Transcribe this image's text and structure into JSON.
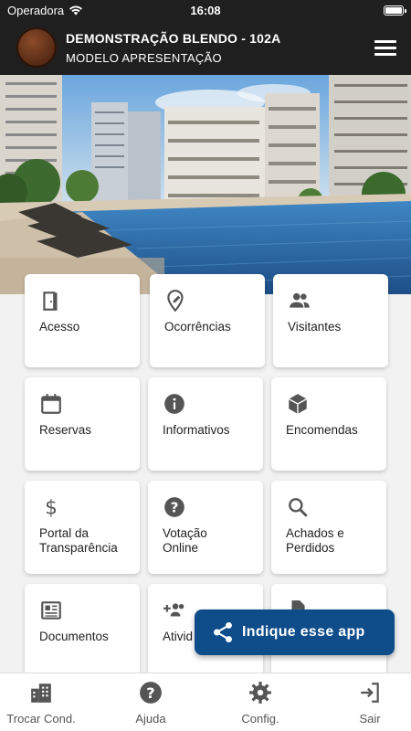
{
  "status_bar": {
    "carrier": "Operadora",
    "time": "16:08"
  },
  "header": {
    "title": "DEMONSTRAÇÃO BLENDO - 102A",
    "subtitle": "MODELO APRESENTAÇÃO"
  },
  "tiles": [
    {
      "label": "Acesso",
      "icon": "door-icon"
    },
    {
      "label": "Ocorrências",
      "icon": "pin-edit-icon"
    },
    {
      "label": "Visitantes",
      "icon": "people-icon"
    },
    {
      "label": "Reservas",
      "icon": "calendar-icon"
    },
    {
      "label": "Informativos",
      "icon": "info-icon"
    },
    {
      "label": "Encomendas",
      "icon": "package-icon"
    },
    {
      "label": "Portal da\nTransparência",
      "icon": "dollar-icon"
    },
    {
      "label": "Votação\nOnline",
      "icon": "help-icon"
    },
    {
      "label": "Achados e\nPerdidos",
      "icon": "search-icon"
    },
    {
      "label": "Documentos",
      "icon": "newspaper-icon"
    },
    {
      "label": "Ativid",
      "icon": "group-add-icon"
    },
    {
      "label": "",
      "icon": "document-icon"
    }
  ],
  "fab": {
    "label": "Indique esse app",
    "icon": "share-icon"
  },
  "bottom_nav": [
    {
      "label": "Trocar Cond.",
      "icon": "buildings-icon"
    },
    {
      "label": "Ajuda",
      "icon": "help-circle-icon"
    },
    {
      "label": "Config.",
      "icon": "gear-icon"
    },
    {
      "label": "Sair",
      "icon": "exit-icon"
    }
  ],
  "colors": {
    "header_bg": "#1f1f1f",
    "fab_bg": "#0f4c8a",
    "icon": "#555555"
  }
}
